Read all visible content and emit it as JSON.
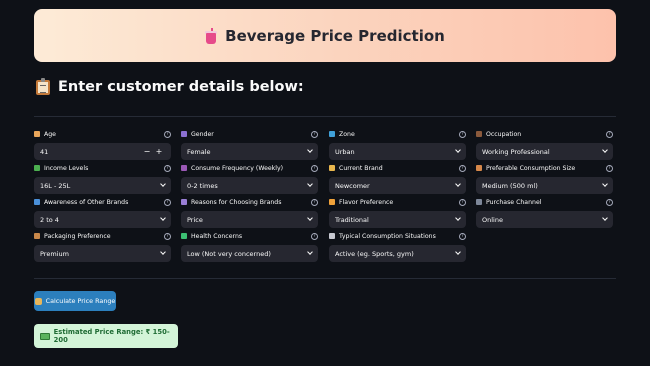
{
  "header": {
    "title": "Beverage Price Prediction",
    "icon": "cup-with-straw-icon"
  },
  "subheader": {
    "text": "Enter customer details below:",
    "icon": "clipboard-icon"
  },
  "fields": [
    {
      "label": "Age",
      "value": "41",
      "type": "number",
      "icon": "id-card-icon",
      "icon_color": "#e8a65b"
    },
    {
      "label": "Gender",
      "value": "Female",
      "type": "select",
      "icon": "people-icon",
      "icon_color": "#8a6fd1"
    },
    {
      "label": "Zone",
      "value": "Urban",
      "type": "select",
      "icon": "globe-icon",
      "icon_color": "#3fa0d8"
    },
    {
      "label": "Occupation",
      "value": "Working Professional",
      "type": "select",
      "icon": "briefcase-icon",
      "icon_color": "#8b5a3c"
    },
    {
      "label": "Income Levels",
      "value": "16L - 25L",
      "type": "select",
      "icon": "money-icon",
      "icon_color": "#4caf50"
    },
    {
      "label": "Consume Frequency (Weekly)",
      "value": "0-2 times",
      "type": "select",
      "icon": "calendar-icon",
      "icon_color": "#9b59b6"
    },
    {
      "label": "Current Brand",
      "value": "Newcomer",
      "type": "select",
      "icon": "tag-icon",
      "icon_color": "#e8b64d"
    },
    {
      "label": "Preferable Consumption Size",
      "value": "Medium (500 ml)",
      "type": "select",
      "icon": "cup-icon",
      "icon_color": "#d6884a"
    },
    {
      "label": "Awareness of Other Brands",
      "value": "2 to 4",
      "type": "select",
      "icon": "magnifier-icon",
      "icon_color": "#4a90d9"
    },
    {
      "label": "Reasons for Choosing Brands",
      "value": "Price",
      "type": "select",
      "icon": "thinking-icon",
      "icon_color": "#9a7fd6"
    },
    {
      "label": "Flavor Preference",
      "value": "Traditional",
      "type": "select",
      "icon": "flavor-icon",
      "icon_color": "#f0a23a"
    },
    {
      "label": "Purchase Channel",
      "value": "Online",
      "type": "select",
      "icon": "cart-icon",
      "icon_color": "#7d8799"
    },
    {
      "label": "Packaging Preference",
      "value": "Premium",
      "type": "select",
      "icon": "package-icon",
      "icon_color": "#c9884a"
    },
    {
      "label": "Health Concerns",
      "value": "Low (Not very concerned)",
      "type": "select",
      "icon": "heart-icon",
      "icon_color": "#3cbf73"
    },
    {
      "label": "Typical Consumption Situations",
      "value": "Active (eg. Sports, gym)",
      "type": "select",
      "icon": "clock-icon",
      "icon_color": "#c7c9d1"
    }
  ],
  "stepper": {
    "minus": "−",
    "plus": "+"
  },
  "help_glyph": "?",
  "button": {
    "label": "Calculate Price Range",
    "icon": "hand-icon"
  },
  "result": {
    "text": "Estimated Price Range: ₹ 150-200",
    "icon": "money-icon"
  }
}
